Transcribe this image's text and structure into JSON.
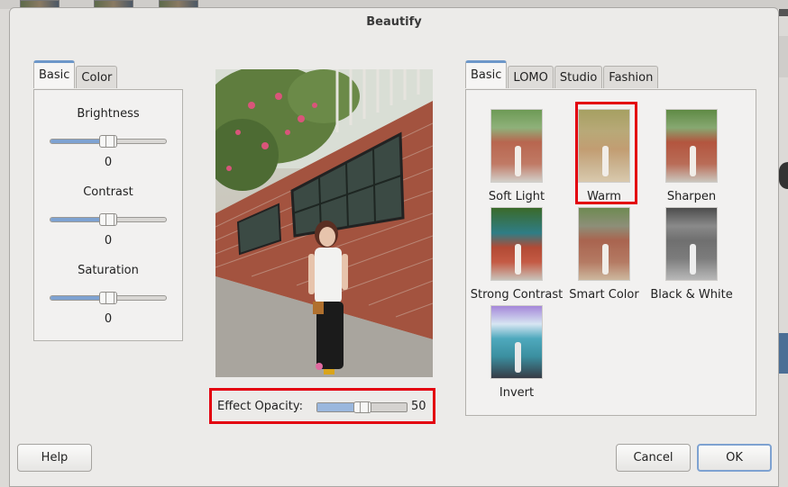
{
  "dialog": {
    "title": "Beautify"
  },
  "left_panel": {
    "tabs": [
      {
        "label": "Basic",
        "active": true
      },
      {
        "label": "Color",
        "active": false
      }
    ],
    "sliders": [
      {
        "label": "Brightness",
        "value": "0",
        "level": 0.5
      },
      {
        "label": "Contrast",
        "value": "0",
        "level": 0.5
      },
      {
        "label": "Saturation",
        "value": "0",
        "level": 0.5
      }
    ]
  },
  "preview": {
    "opacity_label": "Effect Opacity:",
    "opacity_value": "50",
    "opacity_level": 0.5
  },
  "right_panel": {
    "tabs": [
      {
        "label": "Basic",
        "active": true
      },
      {
        "label": "LOMO",
        "active": false
      },
      {
        "label": "Studio",
        "active": false
      },
      {
        "label": "Fashion",
        "active": false
      }
    ],
    "presets": [
      {
        "label": "Soft Light",
        "style": "soft",
        "selected": false
      },
      {
        "label": "Warm",
        "style": "warm",
        "selected": true
      },
      {
        "label": "Sharpen",
        "style": "sharpen",
        "selected": false
      },
      {
        "label": "Strong Contrast",
        "style": "strong",
        "selected": false
      },
      {
        "label": "Smart Color",
        "style": "smart",
        "selected": false
      },
      {
        "label": "Black & White",
        "style": "bw",
        "selected": false
      },
      {
        "label": "Invert",
        "style": "invert",
        "selected": false
      }
    ]
  },
  "buttons": {
    "help": "Help",
    "cancel": "Cancel",
    "ok": "OK"
  },
  "colors": {
    "highlight": "#e3000f",
    "accent": "#7ea2d1"
  }
}
